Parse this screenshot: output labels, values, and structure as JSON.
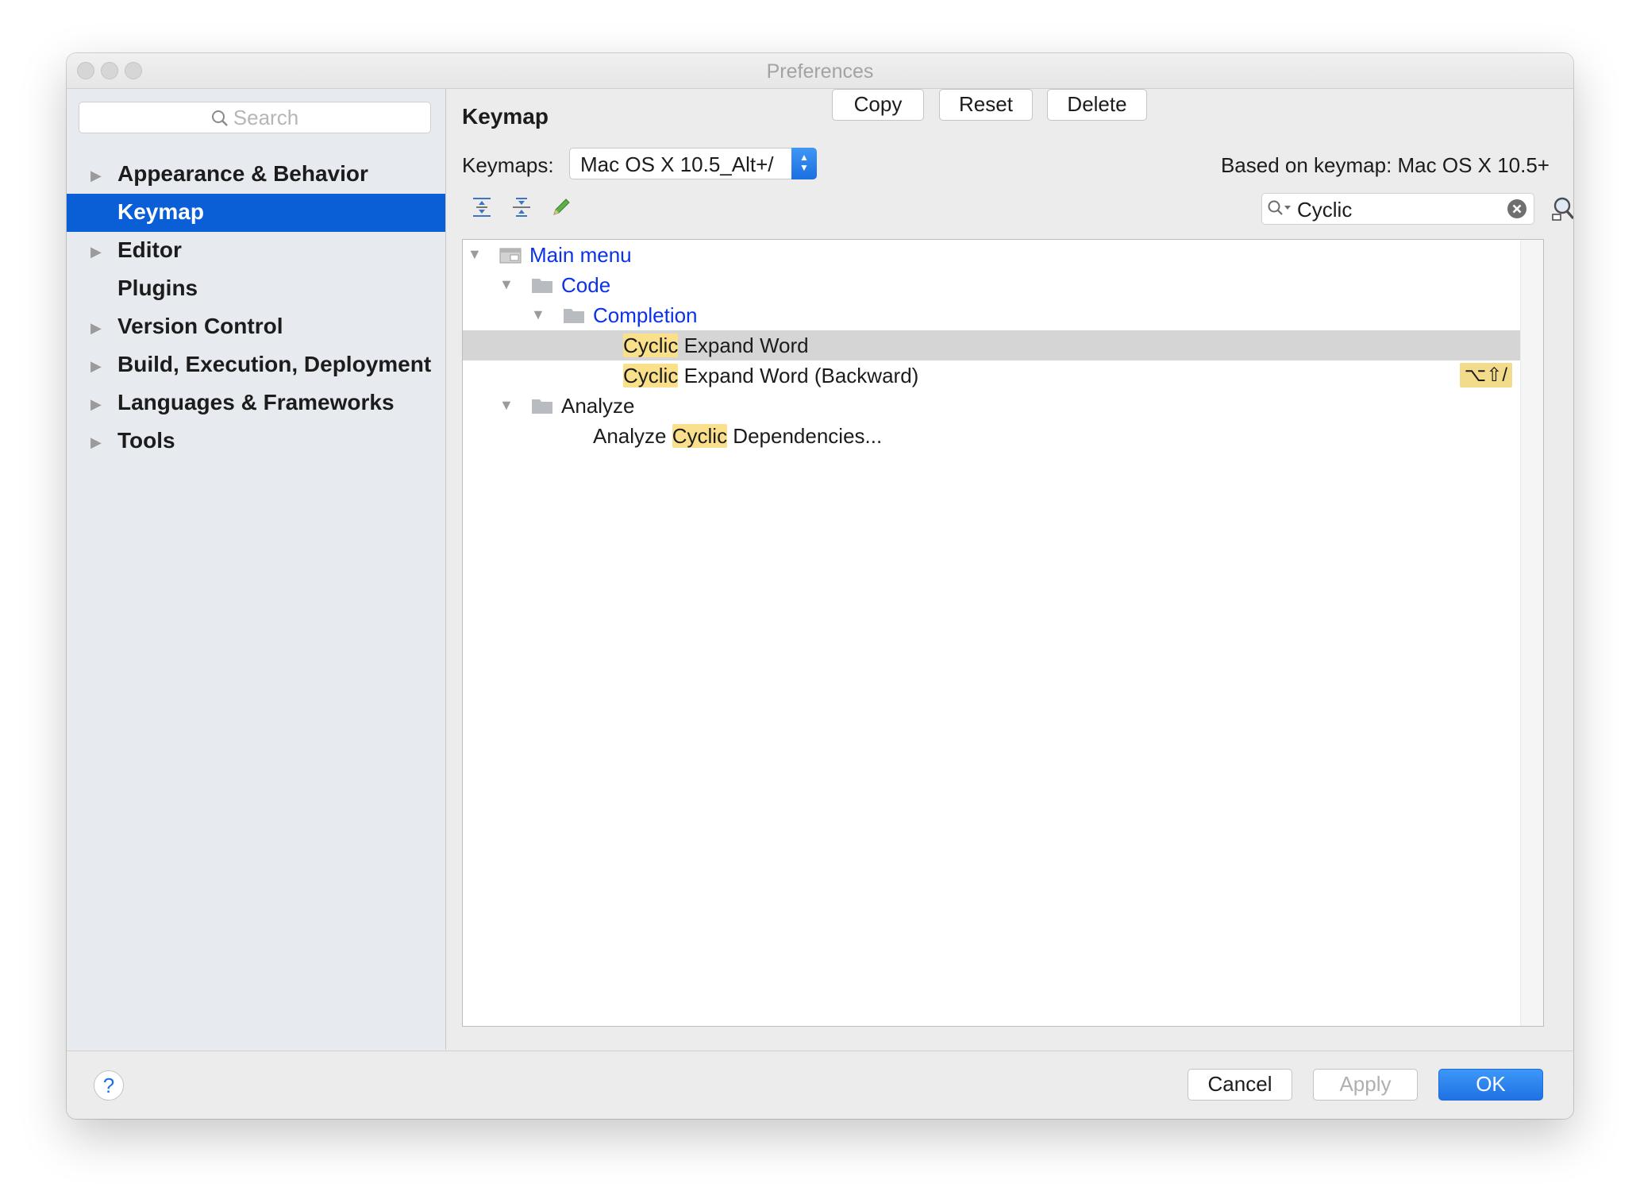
{
  "window": {
    "title": "Preferences"
  },
  "sidebar": {
    "search_placeholder": "Search",
    "items": [
      {
        "label": "Appearance & Behavior",
        "expandable": true
      },
      {
        "label": "Keymap",
        "expandable": false,
        "selected": true
      },
      {
        "label": "Editor",
        "expandable": true
      },
      {
        "label": "Plugins",
        "expandable": false
      },
      {
        "label": "Version Control",
        "expandable": true
      },
      {
        "label": "Build, Execution, Deployment",
        "expandable": true
      },
      {
        "label": "Languages & Frameworks",
        "expandable": true
      },
      {
        "label": "Tools",
        "expandable": true
      }
    ]
  },
  "main": {
    "title": "Keymap",
    "keymaps_label": "Keymaps:",
    "keymap_value": "Mac OS X 10.5_Alt+/",
    "copy_label": "Copy",
    "reset_label": "Reset",
    "delete_label": "Delete",
    "based_on": "Based on keymap: Mac OS X 10.5+",
    "filter_value": "Cyclic",
    "tree": {
      "main_menu": "Main menu",
      "code": "Code",
      "completion": "Completion",
      "item1": {
        "highlight": "Cyclic",
        "rest": " Expand Word"
      },
      "item2": {
        "highlight": "Cyclic",
        "rest": " Expand Word (Backward)",
        "shortcut": "⌥⇧/"
      },
      "analyze": "Analyze",
      "item3": {
        "before": "Analyze ",
        "highlight": "Cyclic",
        "after": " Dependencies..."
      }
    }
  },
  "footer": {
    "help_label": "?",
    "cancel_label": "Cancel",
    "apply_label": "Apply",
    "ok_label": "OK"
  },
  "colors": {
    "accent": "#0b5fd6",
    "highlight": "#fbe08c",
    "link": "#0b32e6"
  }
}
